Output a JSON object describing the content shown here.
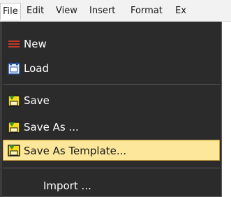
{
  "menubar": {
    "items": [
      {
        "label": "File",
        "active": true
      },
      {
        "label": "Edit"
      },
      {
        "label": "View"
      },
      {
        "label": "Insert"
      },
      {
        "label": "Format"
      },
      {
        "label": "Ex"
      }
    ]
  },
  "file_menu": {
    "items": [
      {
        "label": "New",
        "icon": "new-lines-icon"
      },
      {
        "label": "Load",
        "icon": "load-folder-icon"
      },
      {
        "label": "Save",
        "icon": "save-icon"
      },
      {
        "label": "Save As ...",
        "icon": "save-as-icon"
      },
      {
        "label": "Save As Template...",
        "icon": "save-template-icon",
        "highlighted": true
      },
      {
        "label": "Import ..."
      }
    ]
  },
  "colors": {
    "menu_bg": "#2b2b2b",
    "highlight_bg": "#fde79a",
    "highlight_border": "#c9a23b",
    "icon_yellow": "#f5dc1a",
    "icon_green": "#3a8a2a"
  }
}
